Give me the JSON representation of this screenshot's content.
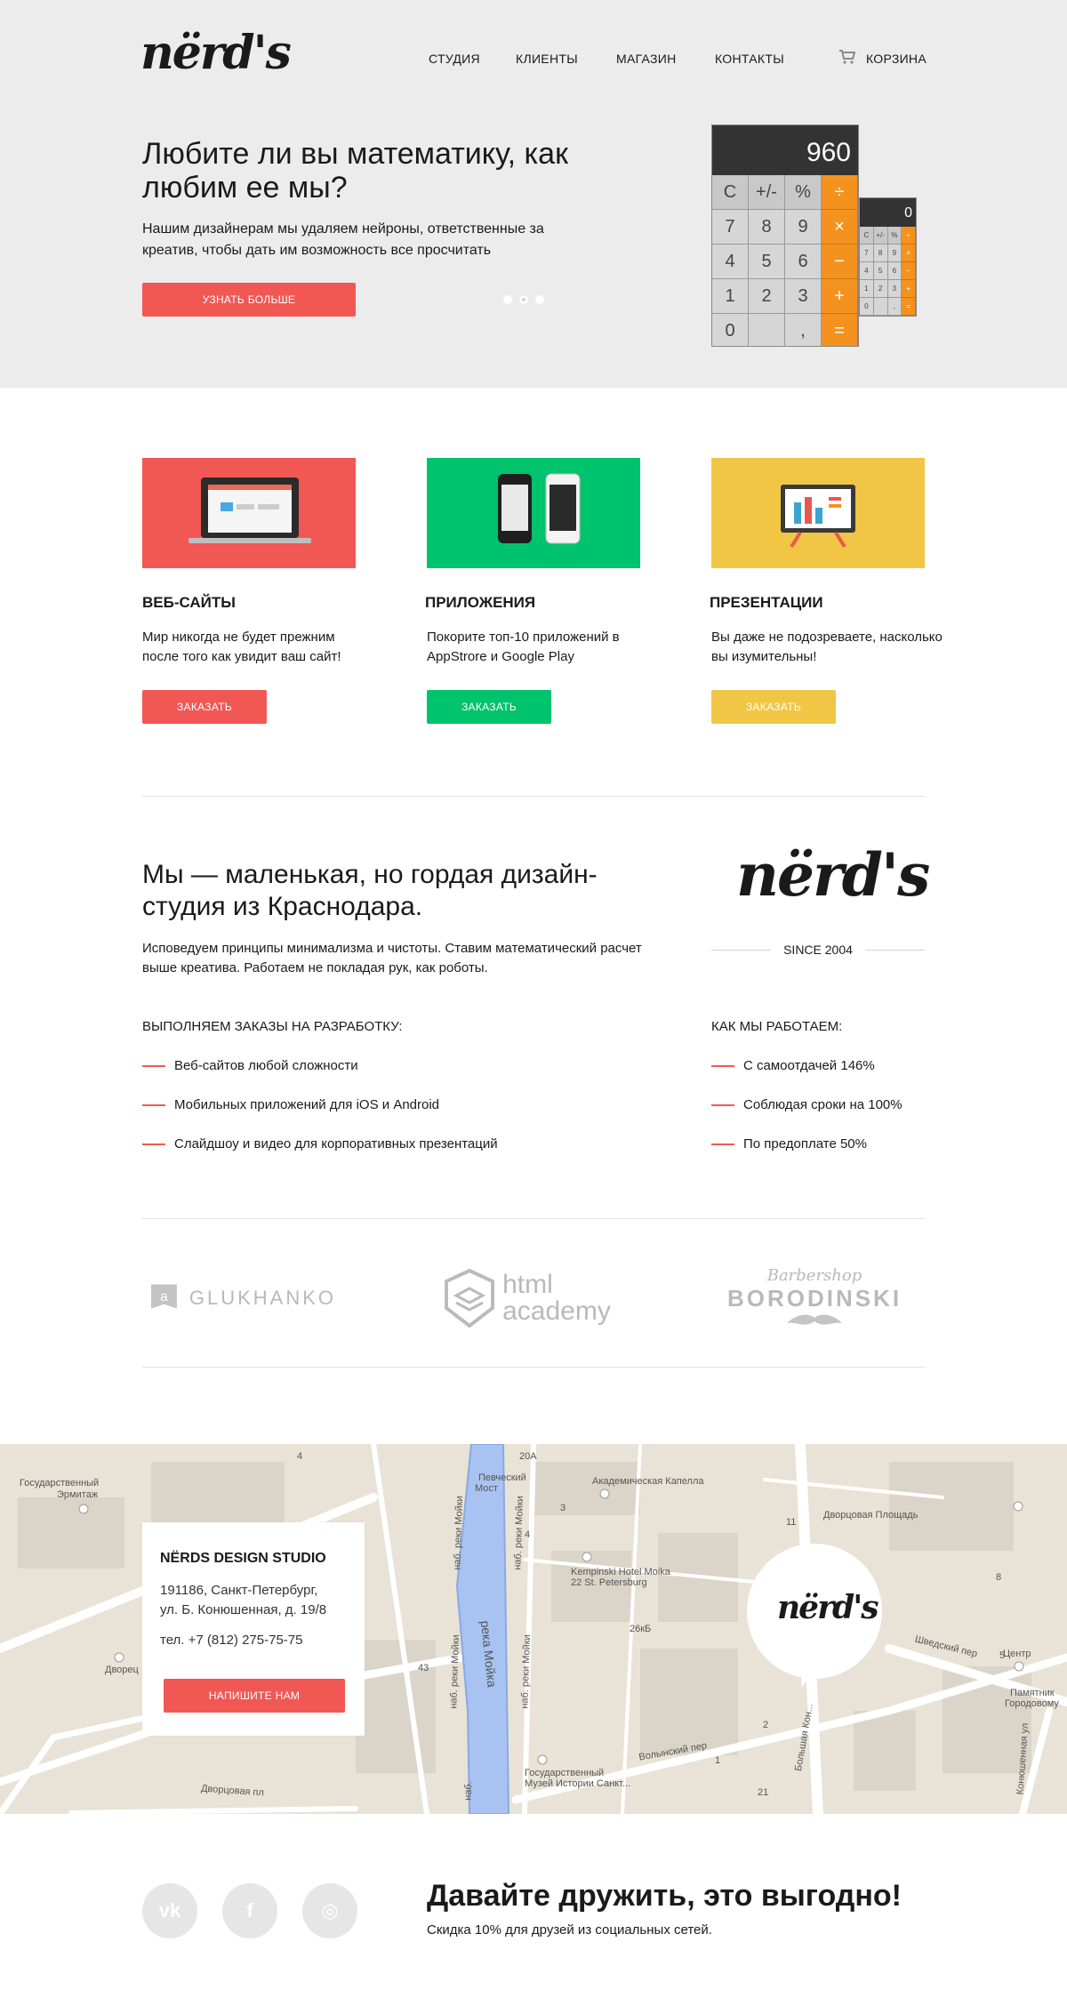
{
  "brand": {
    "logo_text": "nërd's"
  },
  "nav": {
    "items": [
      "СТУДИЯ",
      "КЛИЕНТЫ",
      "МАГАЗИН",
      "КОНТАКТЫ"
    ],
    "cart_label": "КОРЗИНА"
  },
  "hero": {
    "title": "Любите ли вы математику, как любим ее мы?",
    "text": "Нашим дизайнерам мы удаляем нейроны, ответственные за креатив, чтобы дать им возможность все просчитать",
    "button": "УЗНАТЬ БОЛЬШЕ",
    "slides": 3,
    "active_slide": 2,
    "calc_display_big": "960",
    "calc_display_small": "0",
    "calc_keys": [
      "C",
      "+/-",
      "%",
      "÷",
      "7",
      "8",
      "9",
      "×",
      "4",
      "5",
      "6",
      "−",
      "1",
      "2",
      "3",
      "+",
      "0",
      "",
      ",",
      "="
    ]
  },
  "services": [
    {
      "title": "ВЕБ-САЙТЫ",
      "text": "Мир никогда не будет прежним после того как увидит ваш сайт!",
      "button": "ЗАКАЗАТЬ",
      "color": "#f15854"
    },
    {
      "title": "ПРИЛОЖЕНИЯ",
      "text": "Покорите топ-10 приложений в AppStrore и Google Play",
      "button": "ЗАКАЗАТЬ",
      "color": "#00c36d"
    },
    {
      "title": "ПРЕЗЕНТАЦИИ",
      "text": "Вы даже не подозреваете, насколько вы изумительны!",
      "button": "ЗАКАЗАТЬ",
      "color": "#f1c644"
    }
  ],
  "about": {
    "title": "Мы — маленькая, но гордая дизайн-студия из Краснодара.",
    "text": "Исповедуем принципы минимализма и чистоты. Ставим математический расчет выше креатива. Работаем не покладая рук, как роботы.",
    "since": "SINCE 2004",
    "left_list_title": "ВЫПОЛНЯЕМ ЗАКАЗЫ НА РАЗРАБОТКУ:",
    "left_list": [
      "Веб-сайтов любой сложности",
      "Мобильных приложений для iOS и Android",
      "Слайдшоу и видео для корпоративных презентаций"
    ],
    "right_list_title": "КАК МЫ РАБОТАЕМ:",
    "right_list": [
      "С самоотдачей 146%",
      "Соблюдая сроки на 100%",
      "По предоплате 50%"
    ]
  },
  "clients": {
    "glukhanko": "GLUKHANKO",
    "academy_1": "html",
    "academy_2": "academy",
    "barbershop": "Barbershop",
    "borodinski": "BORODINSKI"
  },
  "map": {
    "labels": {
      "ermitazh_1": "Государственный",
      "ermitazh_2": "Эрмитаж",
      "pevchesky_1": "Певческий",
      "pevchesky_2": "Мост",
      "capella": "Академическая Капелла",
      "dvortsovaya_sq": "Дворцовая Площадь",
      "kempinski_1": "Kempinski Hotel Moika",
      "kempinski_2": "22 St. Petersburg",
      "shvedsky": "Шведский пер",
      "center": "Центр",
      "monument_1": "Памятник",
      "monument_2": "Городовому",
      "volynsky": "Волынский пер",
      "museum_1": "Государственный",
      "museum_2": "Музей Истории Санкт...",
      "dvortsovaya_pl": "Дворцовая пл",
      "dvorets": "Дворец",
      "reka_moika": "река Мойка",
      "nab_1": "наб. реки Мойки",
      "nab_2": "наб. реки Мойки",
      "nab_3": "наб. реки Мойки",
      "nab_4": "наб. реки Мойки",
      "nab_5": "наб.",
      "bolshaya_kon": "Большая Кон...",
      "konyushennaya": "Конюшенная ул",
      "num_4a": "4",
      "num_20a": "20А",
      "num_3": "3",
      "num_4b": "4",
      "num_11": "11",
      "num_43": "43",
      "num_26kb": "26кБ",
      "num_21": "21",
      "num_2": "2",
      "num_1": "1",
      "num_8": "8",
      "num_5": "5"
    },
    "card": {
      "title": "NЁRDS DESIGN STUDIO",
      "address_1": "191186, Санкт-Петербург,",
      "address_2": "ул. Б. Конюшенная, д. 19/8",
      "phone": "тел. +7 (812) 275-75-75",
      "button": "НАПИШИТЕ НАМ"
    }
  },
  "footer": {
    "social": [
      {
        "name": "vk-icon",
        "glyph": "vk"
      },
      {
        "name": "facebook-icon",
        "glyph": "f"
      },
      {
        "name": "instagram-icon",
        "glyph": "◎"
      }
    ],
    "title": "Давайте дружить, это выгодно!",
    "text": "Скидка 10% для друзей из социальных сетей."
  }
}
